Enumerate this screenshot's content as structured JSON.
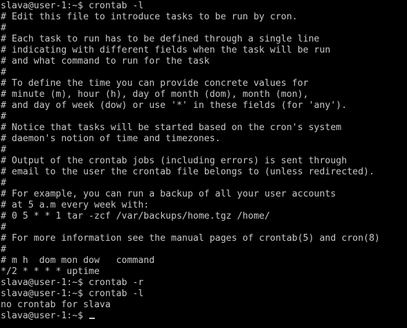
{
  "terminal": {
    "lines": [
      "slava@user-1:~$ crontab -l",
      "# Edit this file to introduce tasks to be run by cron.",
      "#",
      "# Each task to run has to be defined through a single line",
      "# indicating with different fields when the task will be run",
      "# and what command to run for the task",
      "#",
      "# To define the time you can provide concrete values for",
      "# minute (m), hour (h), day of month (dom), month (mon),",
      "# and day of week (dow) or use '*' in these fields (for 'any').",
      "#",
      "# Notice that tasks will be started based on the cron's system",
      "# daemon's notion of time and timezones.",
      "#",
      "# Output of the crontab jobs (including errors) is sent through",
      "# email to the user the crontab file belongs to (unless redirected).",
      "#",
      "# For example, you can run a backup of all your user accounts",
      "# at 5 a.m every week with:",
      "# 0 5 * * 1 tar -zcf /var/backups/home.tgz /home/",
      "#",
      "# For more information see the manual pages of crontab(5) and cron(8)",
      "#",
      "# m h  dom mon dow   command",
      "*/2 * * * * uptime",
      "slava@user-1:~$ crontab -r",
      "slava@user-1:~$ crontab -l",
      "no crontab for slava"
    ],
    "prompt": "slava@user-1:~$ "
  },
  "colors": {
    "background": "#000000",
    "foreground": "#c8c8c8"
  }
}
